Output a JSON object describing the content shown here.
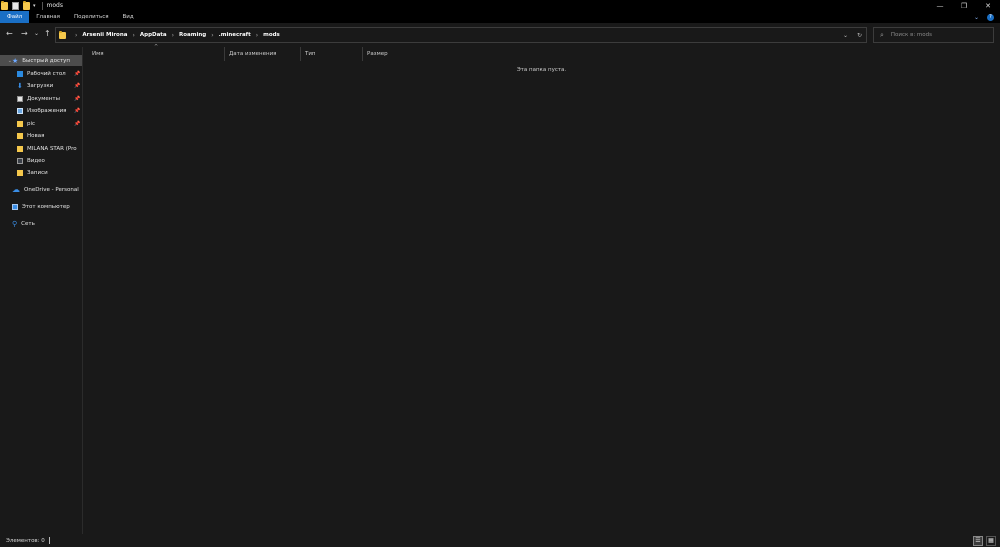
{
  "window": {
    "title": "mods",
    "restore_glyph": "❐",
    "close_glyph": "✕",
    "minimize_glyph": "—"
  },
  "ribbon": {
    "tabs": [
      "Файл",
      "Главная",
      "Поделиться",
      "Вид"
    ]
  },
  "nav": {
    "back": "←",
    "forward": "→",
    "history": "⌄",
    "up": "↑"
  },
  "address": {
    "crumbs": [
      "Arsenii Mirona",
      "AppData",
      "Roaming",
      ".minecraft",
      "mods"
    ],
    "dropdown_glyph": "⌄",
    "refresh_glyph": "↻"
  },
  "search": {
    "placeholder": "Поиск в: mods"
  },
  "sidebar": {
    "items": [
      {
        "label": "Быстрый доступ",
        "icon": "star-icon"
      },
      {
        "label": "Рабочий стол",
        "icon": "desktop-icon",
        "pinned": true
      },
      {
        "label": "Загрузки",
        "icon": "downloads-icon",
        "pinned": true
      },
      {
        "label": "Документы",
        "icon": "documents-icon",
        "pinned": true
      },
      {
        "label": "Изображения",
        "icon": "pictures-icon",
        "pinned": true
      },
      {
        "label": "pic",
        "icon": "folder-icon",
        "pinned": true
      },
      {
        "label": "Новая",
        "icon": "folder-icon"
      },
      {
        "label": "MILANA STAR (Pro",
        "icon": "folder-icon"
      },
      {
        "label": "Видео",
        "icon": "videos-icon"
      },
      {
        "label": "Записи",
        "icon": "folder-icon"
      },
      {
        "label": "OneDrive - Personal",
        "icon": "onedrive-icon"
      },
      {
        "label": "Этот компьютер",
        "icon": "computer-icon"
      },
      {
        "label": "Сеть",
        "icon": "network-icon"
      }
    ]
  },
  "columns": {
    "name": "Имя",
    "date": "Дата изменения",
    "type": "Тип",
    "size": "Размер"
  },
  "content": {
    "empty_message": "Эта папка пуста."
  },
  "status": {
    "items": "Элементов: 0"
  },
  "colors": {
    "accent": "#1a6fc5",
    "background": "#191919",
    "selected": "#4d4d4d"
  }
}
